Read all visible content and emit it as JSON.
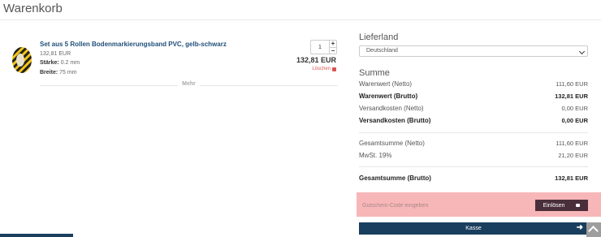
{
  "page": {
    "title": "Warenkorb"
  },
  "cart": {
    "item": {
      "name": "Set aus 5 Rollen Bodenmarkierungsband PVC, gelb-schwarz",
      "unit_price": "132,81 EUR",
      "attributes": [
        {
          "label": "Stärke:",
          "value": "0.2 mm"
        },
        {
          "label": "Breite:",
          "value": "75 mm"
        }
      ],
      "quantity": "1",
      "plus": "+",
      "minus": "−",
      "line_total": "132,81 EUR",
      "delete_label": "Löschen"
    },
    "more_label": "Mehr"
  },
  "shipping": {
    "heading": "Lieferland",
    "country": "Deutschland"
  },
  "summary": {
    "heading": "Summe",
    "rows": [
      {
        "label": "Warenwert (Netto)",
        "value": "111,60 EUR"
      },
      {
        "label": "Warenwert (Brutto)",
        "value": "132,81 EUR"
      },
      {
        "label": "Versandkosten (Netto)",
        "value": "0,00 EUR"
      },
      {
        "label": "Versandkosten (Brutto)",
        "value": "0,00 EUR"
      },
      {
        "label": "Gesamtsumme (Netto)",
        "value": "111,60 EUR"
      },
      {
        "label": "MwSt. 19%",
        "value": "21,20 EUR"
      },
      {
        "label": "Gesamtsumme (Brutto)",
        "value": "132,81 EUR"
      }
    ]
  },
  "coupon": {
    "placeholder": "Gutschein-Code eingeben",
    "button_label": "Einlösen"
  },
  "checkout": {
    "label": "Kasse",
    "arrow": "➜"
  },
  "colors": {
    "link_blue": "#1f4e79",
    "primary": "#1a3e5e",
    "delete_red": "#d9534f",
    "coupon_highlight": "#f7b6b8",
    "redeem_button": "#4a2f3a"
  }
}
